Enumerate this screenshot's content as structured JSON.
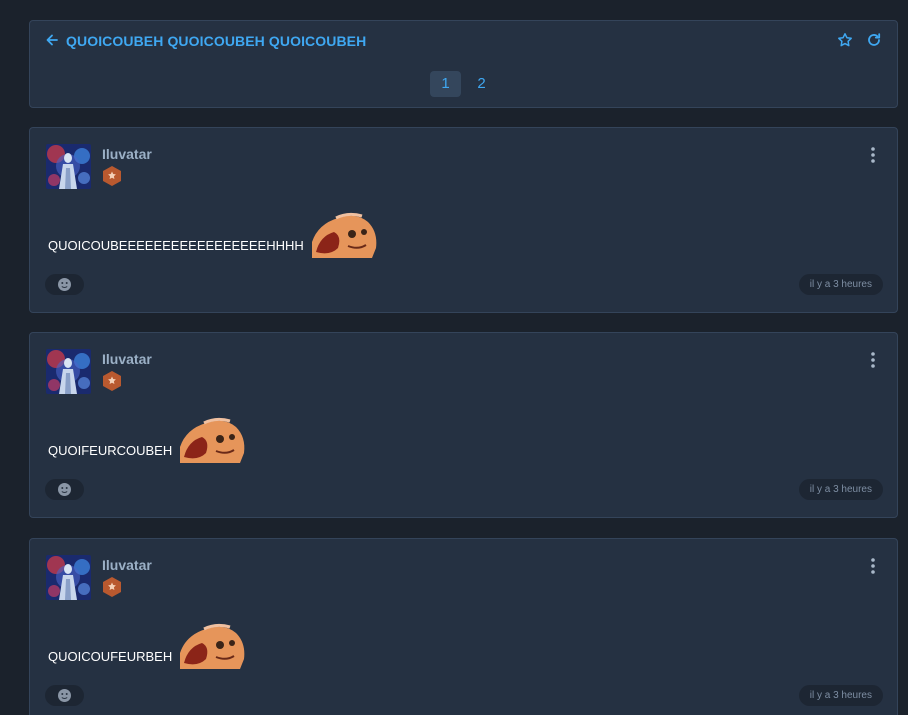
{
  "topic": {
    "title": "QUOICOUBEH QUOICOUBEH QUOICOUBEH",
    "pages": [
      "1",
      "2"
    ],
    "current_page": "1",
    "accent": "#3fa8f2"
  },
  "posts": [
    {
      "author": "Iluvatar",
      "content": "QUOICOUBEEEEEEEEEEEEEEEEEHHHH",
      "time": "il y a 3 heures"
    },
    {
      "author": "Iluvatar",
      "content": "QUOIFEURCOUBEH",
      "time": "il y a 3 heures"
    },
    {
      "author": "Iluvatar",
      "content": "QUOICOUFEURBEH",
      "time": "il y a 3 heures"
    }
  ],
  "icons": {
    "back": "arrow-left-icon",
    "favorite": "star-icon",
    "refresh": "refresh-icon",
    "menu": "more-vertical-icon",
    "reaction": "emoji-icon",
    "badge": "rank-badge-icon"
  }
}
